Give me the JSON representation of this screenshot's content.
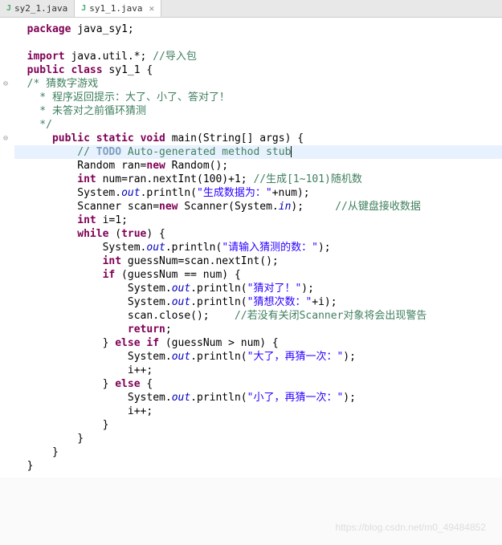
{
  "tabs": [
    {
      "label": "sy2_1.java",
      "active": false
    },
    {
      "label": "sy1_1.java",
      "active": true
    }
  ],
  "gutter": {
    "mark0": "",
    "mark1": "⊖",
    "mark2": "⊖"
  },
  "code": {
    "package_kw": "package",
    "package_name": " java_sy1;",
    "import_kw": "import",
    "import_name": " java.util.*; ",
    "import_com": "//导入包",
    "public_kw": "public",
    "class_kw": "class",
    "class_name": " sy1_1 {",
    "doc1": "/* 猜数字游戏",
    "doc2": " * 程序返回提示：大了、小了、答对了！",
    "doc3": " * 未答对之前循环猜测",
    "doc4": " */",
    "static_kw": "static",
    "void_kw": "void",
    "main_sig_a": " main(String[] args) {",
    "todo_lead": "// ",
    "todo_kw": "TODO",
    "todo_rest": " Auto-generated method stub",
    "line_random_a": "Random ran=",
    "new_kw": "new",
    "line_random_b": " Random();",
    "int_kw": "int",
    "line_num_a": " num=ran.nextInt(100)+1; ",
    "line_num_com": "//生成[1~101)随机数",
    "sys_a": "System.",
    "out_field": "out",
    "println_a": ".println(",
    "str_gen": "\"生成数据为：\"",
    "plus_num": "+num);",
    "line_scan_a": "Scanner scan=",
    "line_scan_b": " Scanner(System.",
    "in_field": "in",
    "line_scan_c": ");",
    "scan_com": "//从键盘接收数据",
    "line_i": " i=1;",
    "while_kw": "while",
    "true_kw": "true",
    "while_a": " (",
    "while_b": ") {",
    "str_input": "\"请输入猜测的数：\"",
    "close_paren": ");",
    "line_guess": " guessNum=scan.nextInt();",
    "if_kw": "if",
    "if_cond": " (guessNum == num) {",
    "str_correct": "\"猜对了！\"",
    "str_count": "\"猜想次数：\"",
    "plus_i": "+i);",
    "line_close": "scan.close();",
    "close_com": "//若没有关闭Scanner对象将会出现警告",
    "return_kw": "return",
    "return_semi": ";",
    "else_kw": "else",
    "elseif_a": "} ",
    "elseif_b": " (guessNum > num) {",
    "str_big": "\"大了，再猜一次：\"",
    "line_ipp": "i++;",
    "else_a": "} ",
    "else_b": " {",
    "str_small": "\"小了，再猜一次：\"",
    "brace_close": "}",
    "watermark": "https://blog.csdn.net/m0_49484852"
  }
}
